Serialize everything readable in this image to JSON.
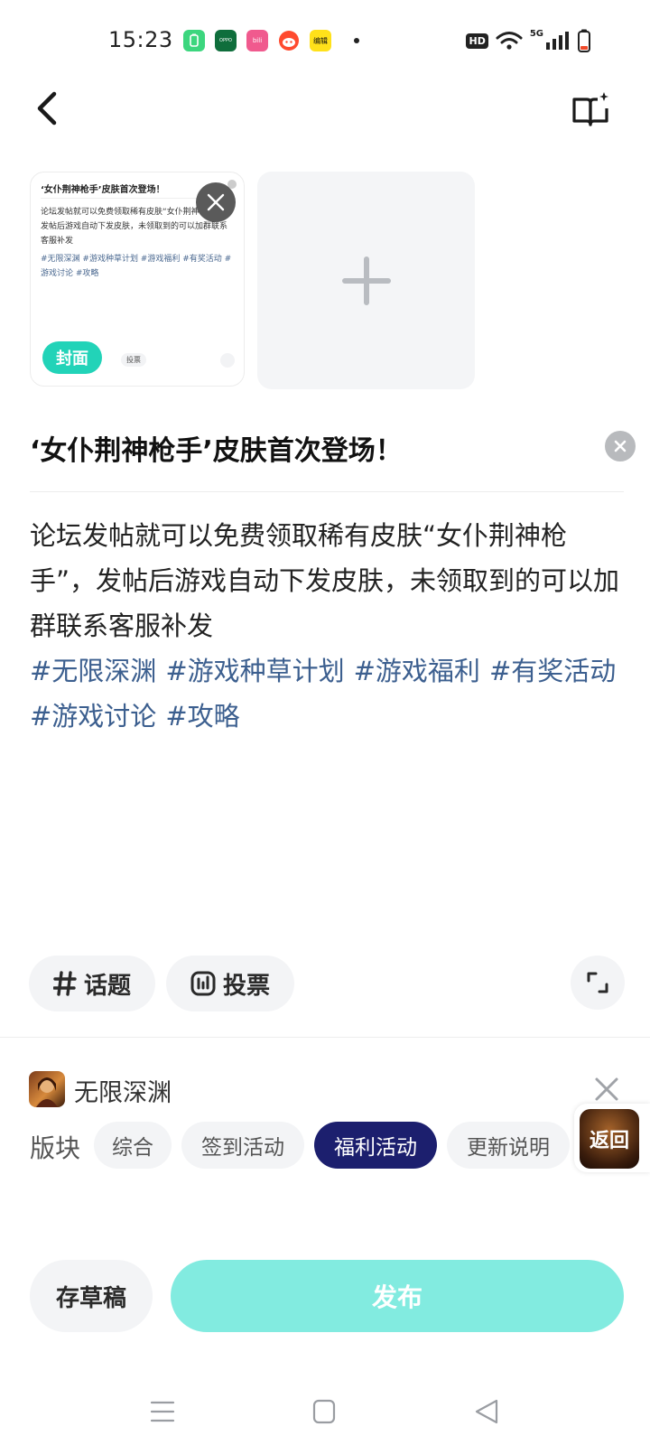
{
  "status_bar": {
    "time": "15:23",
    "hd_label": "HD",
    "network_label": "5G",
    "notification_icons": [
      "battery-app-icon",
      "oppo-app-icon",
      "bilibili-app-icon",
      "reddit-app-icon",
      "news-app-icon"
    ],
    "notification_text": {
      "oppo": "OPPO",
      "bili": "bili",
      "news": "编辑"
    }
  },
  "header": {
    "back_icon": "chevron-left-icon",
    "guide_icon": "book-sparkle-icon"
  },
  "images": {
    "thumbnail": {
      "title": "‘女仆荆神枪手’皮肤首次登场！",
      "body": "论坛发帖就可以免费领取稀有皮肤“女仆荆神枪手”，发帖后游戏自动下发皮肤，未领取到的可以加群联系客服补发",
      "tags": "#无限深渊 #游戏种草计划 #游戏福利 #有奖活动 #游戏讨论 #攻略",
      "vote_label": "投票"
    },
    "cover_label": "封面",
    "add_icon": "plus-icon"
  },
  "post": {
    "title": "‘女仆荆神枪手’皮肤首次登场！",
    "body": "论坛发帖就可以免费领取稀有皮肤“女仆荆神枪手”，发帖后游戏自动下发皮肤，未领取到的可以加群联系客服补发",
    "tags": [
      "#无限深渊",
      "#游戏种草计划",
      "#游戏福利",
      "#有奖活动",
      "#游戏讨论",
      "#攻略"
    ]
  },
  "toolbar": {
    "topic_label": "话题",
    "vote_label": "投票"
  },
  "game": {
    "name": "无限深渊",
    "board_label": "版块",
    "boards": [
      {
        "label": "综合",
        "active": false
      },
      {
        "label": "签到活动",
        "active": false
      },
      {
        "label": "福利活动",
        "active": true
      },
      {
        "label": "更新说明",
        "active": false
      }
    ],
    "return_label": "返回"
  },
  "actions": {
    "draft_label": "存草稿",
    "publish_label": "发布"
  },
  "colors": {
    "accent": "#22d3b8",
    "publish_bg": "#82ebe0",
    "active_board_bg": "#1c1f6e",
    "tag_color": "#3c5f8f"
  }
}
